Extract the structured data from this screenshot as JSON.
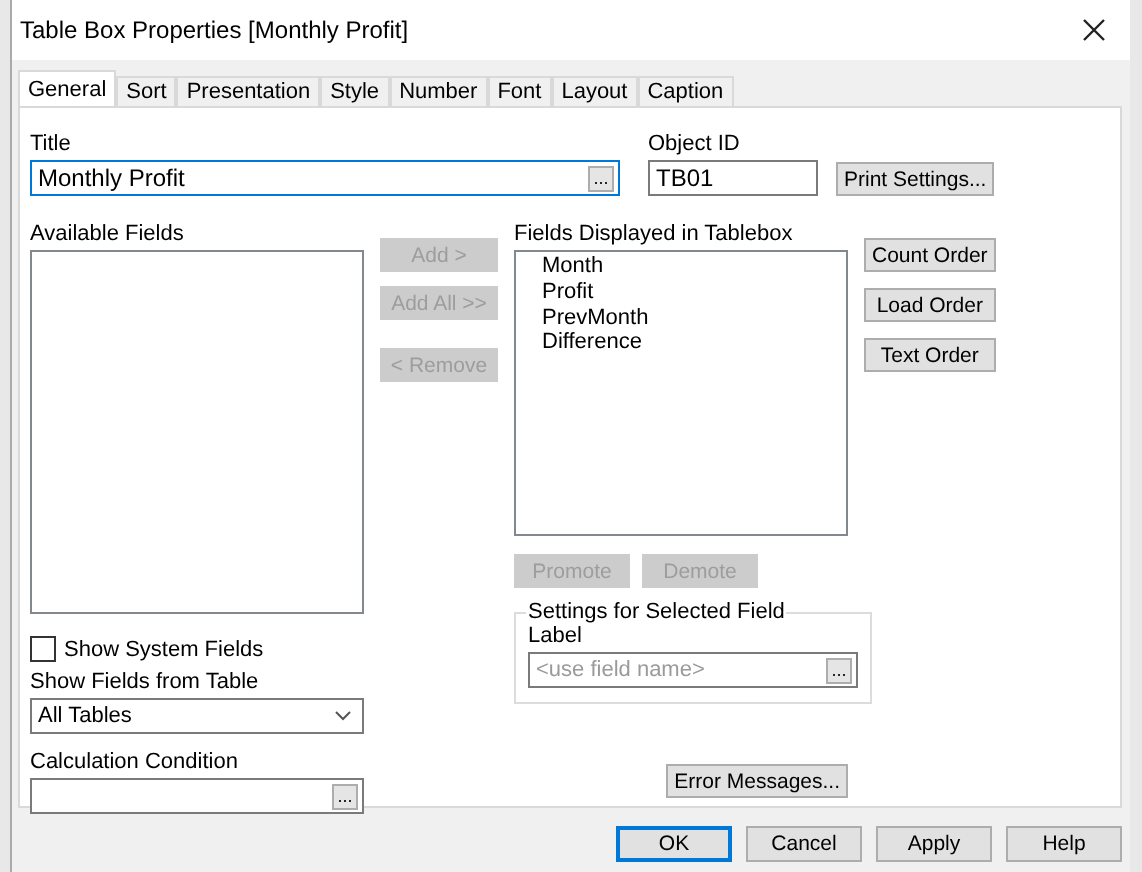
{
  "window": {
    "title": "Table Box Properties [Monthly Profit]"
  },
  "tabs": [
    {
      "label": "General",
      "selected": true
    },
    {
      "label": "Sort",
      "selected": false
    },
    {
      "label": "Presentation",
      "selected": false
    },
    {
      "label": "Style",
      "selected": false
    },
    {
      "label": "Number",
      "selected": false
    },
    {
      "label": "Font",
      "selected": false
    },
    {
      "label": "Layout",
      "selected": false
    },
    {
      "label": "Caption",
      "selected": false
    }
  ],
  "title_field": {
    "label": "Title",
    "value": "Monthly Profit",
    "browse": "..."
  },
  "object_id": {
    "label": "Object ID",
    "value": "TB01"
  },
  "print_settings": {
    "label": "Print Settings...",
    "disabled": false
  },
  "available_fields": {
    "label": "Available Fields"
  },
  "move_buttons": [
    {
      "label": "Add >",
      "disabled": true
    },
    {
      "label": "Add All >>",
      "disabled": true
    },
    {
      "label": "< Remove",
      "disabled": true
    }
  ],
  "displayed_fields": {
    "label": "Fields Displayed in Tablebox",
    "items": [
      "Month",
      "Profit",
      "PrevMonth",
      "Difference"
    ]
  },
  "order_buttons": [
    {
      "label": "Count Order",
      "disabled": false
    },
    {
      "label": "Load Order",
      "disabled": false
    },
    {
      "label": "Text Order",
      "disabled": false
    }
  ],
  "position_buttons": [
    {
      "label": "Promote",
      "disabled": true
    },
    {
      "label": "Demote",
      "disabled": true
    }
  ],
  "show_system_fields": {
    "label": "Show System Fields",
    "checked": false
  },
  "show_fields_from_table": {
    "label": "Show Fields from Table",
    "value": "All Tables"
  },
  "calculation_condition": {
    "label": "Calculation Condition",
    "browse": "..."
  },
  "selected_field_settings": {
    "legend": "Settings for Selected Field",
    "label": "Label",
    "placeholder": "<use field name>",
    "browse": "..."
  },
  "error_messages": {
    "label": "Error Messages...",
    "disabled": false
  },
  "footer_buttons": [
    {
      "label": "OK",
      "default": true
    },
    {
      "label": "Cancel",
      "default": false
    },
    {
      "label": "Apply",
      "default": false
    },
    {
      "label": "Help",
      "default": false
    }
  ]
}
